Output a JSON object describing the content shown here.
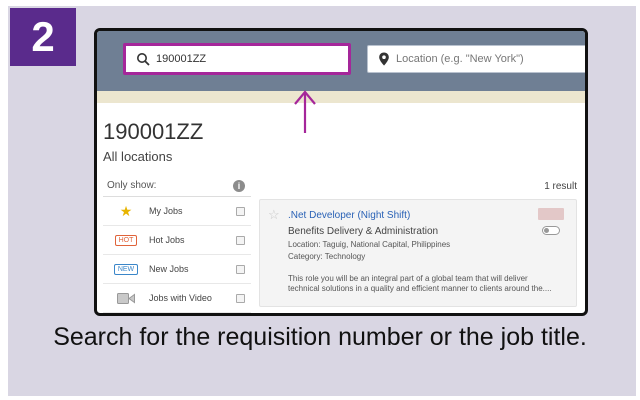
{
  "step": {
    "number": "2",
    "color": "#5a2b8c"
  },
  "search": {
    "query": "190001ZZ",
    "location_placeholder": "Location (e.g. \"New York\")",
    "highlight_color": "#a5269a"
  },
  "results": {
    "title": "190001ZZ",
    "location": "All locations",
    "count": "1 result"
  },
  "filters": {
    "heading": "Only show:",
    "info_icon": "i",
    "items": [
      {
        "label": "My Jobs",
        "icon": "star-icon"
      },
      {
        "label": "Hot Jobs",
        "tag": "HOT"
      },
      {
        "label": "New Jobs",
        "tag": "NEW"
      },
      {
        "label": "Jobs with Video",
        "icon": "video-icon"
      }
    ]
  },
  "job": {
    "title": ".Net Developer (Night Shift)",
    "department": "Benefits Delivery & Administration",
    "location": "Location: Taguig, National Capital, Philippines",
    "category": "Category: Technology",
    "description": "This role you will be an integral part of a global team that will deliver technical solutions in a quality and efficient manner to clients around the...."
  },
  "caption": "Search for the requisition number or the job title."
}
